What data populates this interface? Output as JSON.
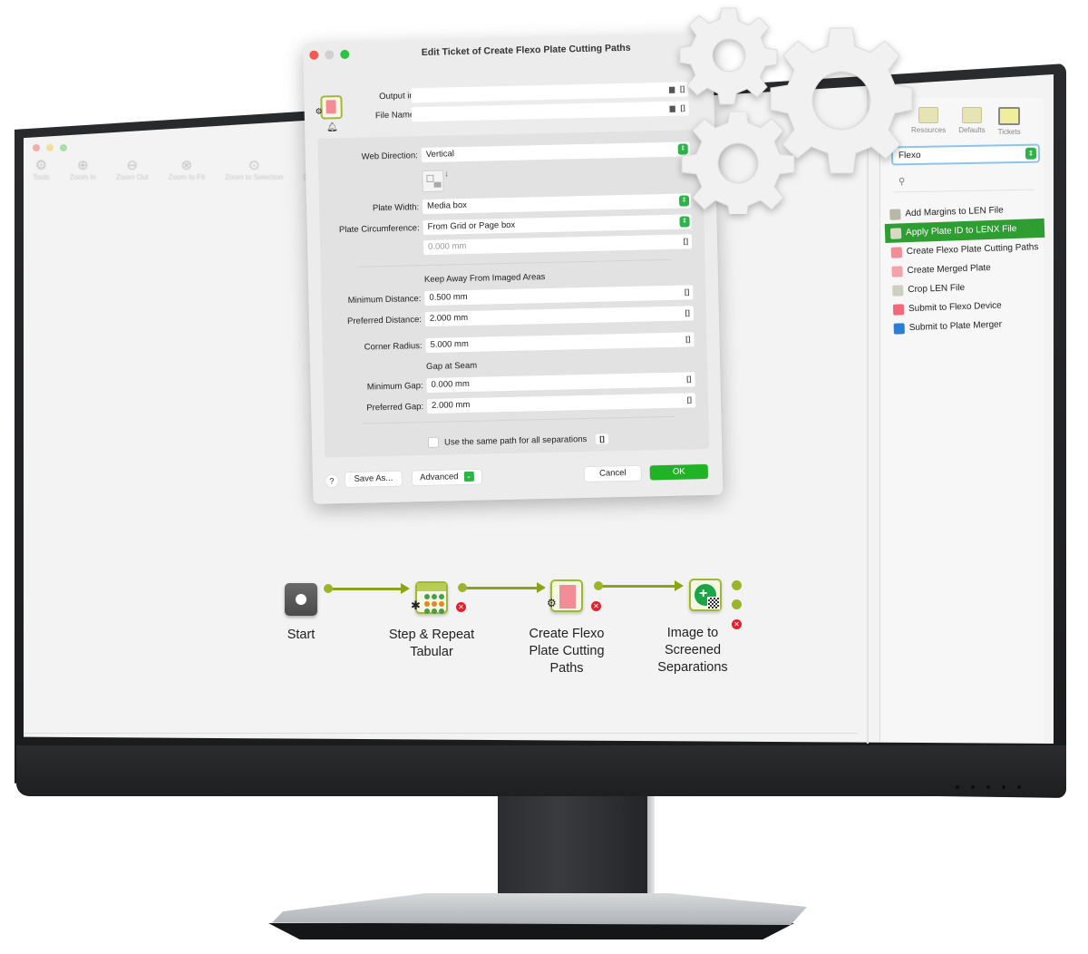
{
  "background_app": {
    "window_controls": [
      "close",
      "minimize",
      "zoom"
    ],
    "toolbar": [
      {
        "label": "Tools",
        "icon": "gear-icon"
      },
      {
        "label": "Zoom In",
        "icon": "zoom-in-icon"
      },
      {
        "label": "Zoom Out",
        "icon": "zoom-out-icon"
      },
      {
        "label": "Zoom to Fit",
        "icon": "zoom-fit-icon"
      },
      {
        "label": "Zoom to Selection",
        "icon": "zoom-selection-icon"
      },
      {
        "label": "Delete",
        "icon": "delete-icon"
      }
    ]
  },
  "right_panel": {
    "tabs": [
      {
        "label": "Resources",
        "icon": "resources-icon"
      },
      {
        "label": "Defaults",
        "icon": "defaults-icon"
      },
      {
        "label": "Tickets",
        "icon": "tickets-icon"
      }
    ],
    "category_select": "Flexo",
    "search_placeholder": "",
    "items": [
      {
        "label": "Add Margins to LEN File",
        "selected": false,
        "icon_color": "#b8b8a8"
      },
      {
        "label": "Apply Plate ID to LENX File",
        "selected": true,
        "icon_color": "#d8d8c8"
      },
      {
        "label": "Create Flexo Plate Cutting Paths",
        "selected": false,
        "icon_color": "#f28d96"
      },
      {
        "label": "Create Merged Plate",
        "selected": false,
        "icon_color": "#f4a3aa"
      },
      {
        "label": "Crop LEN File",
        "selected": false,
        "icon_color": "#cfcfbf"
      },
      {
        "label": "Submit to Flexo Device",
        "selected": false,
        "icon_color": "#ef6b7a"
      },
      {
        "label": "Submit to Plate Merger",
        "selected": false,
        "icon_color": "#2a7fd4"
      }
    ],
    "accent_color": "#2f9e32"
  },
  "dialog": {
    "title": "Edit Ticket of Create Flexo Plate Cutting Paths",
    "output_in": {
      "label": "Output in:",
      "value": ""
    },
    "file_name": {
      "label": "File Name:",
      "value": ""
    },
    "web_direction": {
      "label": "Web Direction:",
      "value": "Vertical"
    },
    "plate_width": {
      "label": "Plate Width:",
      "value": "Media box"
    },
    "plate_circumference": {
      "label": "Plate Circumference:",
      "value": "From Grid or Page box",
      "sub_value": "0.000 mm"
    },
    "keep_away_title": "Keep Away From Imaged Areas",
    "minimum_distance": {
      "label": "Minimum Distance:",
      "value": "0.500 mm"
    },
    "preferred_distance": {
      "label": "Preferred Distance:",
      "value": "2.000 mm"
    },
    "corner_radius": {
      "label": "Corner Radius:",
      "value": "5.000 mm"
    },
    "gap_title": "Gap at Seam",
    "minimum_gap": {
      "label": "Minimum Gap:",
      "value": "0.000 mm"
    },
    "preferred_gap": {
      "label": "Preferred Gap:",
      "value": "2.000 mm"
    },
    "same_path": {
      "label": "Use the same path for all separations",
      "checked": false
    },
    "variable_glyph": "[]",
    "folder_glyph": "▆",
    "stepper_glyph": "⇕",
    "buttons": {
      "help": "?",
      "save_as": "Save As...",
      "advanced": "Advanced",
      "cancel": "Cancel",
      "ok": "OK"
    },
    "ok_color": "#21b326"
  },
  "workflow": {
    "nodes": [
      {
        "label_lines": [
          "Start"
        ]
      },
      {
        "label_lines": [
          "Step & Repeat",
          "Tabular"
        ]
      },
      {
        "label_lines": [
          "Create Flexo",
          "Plate Cutting",
          "Paths"
        ]
      },
      {
        "label_lines": [
          "Image to",
          "Screened",
          "Separations"
        ]
      }
    ],
    "connector_color": "#8aa31b",
    "error_glyph": "✕"
  }
}
